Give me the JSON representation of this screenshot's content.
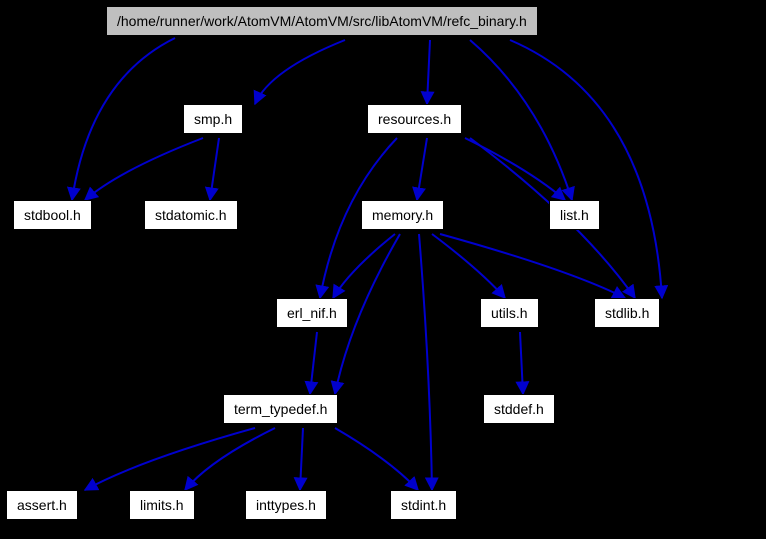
{
  "nodes": {
    "root": {
      "label": "/home/runner/work/AtomVM/AtomVM/src/libAtomVM/refc_binary.h"
    },
    "smp": {
      "label": "smp.h"
    },
    "resources": {
      "label": "resources.h"
    },
    "stdbool": {
      "label": "stdbool.h"
    },
    "stdatomic": {
      "label": "stdatomic.h"
    },
    "memory": {
      "label": "memory.h"
    },
    "list": {
      "label": "list.h"
    },
    "erl_nif": {
      "label": "erl_nif.h"
    },
    "utils": {
      "label": "utils.h"
    },
    "stdlib": {
      "label": "stdlib.h"
    },
    "term_typedef": {
      "label": "term_typedef.h"
    },
    "stddef": {
      "label": "stddef.h"
    },
    "assert": {
      "label": "assert.h"
    },
    "limits": {
      "label": "limits.h"
    },
    "inttypes": {
      "label": "inttypes.h"
    },
    "stdint": {
      "label": "stdint.h"
    }
  },
  "edges": [
    {
      "from": "root",
      "to": "smp"
    },
    {
      "from": "root",
      "to": "resources"
    },
    {
      "from": "root",
      "to": "stdbool"
    },
    {
      "from": "root",
      "to": "list"
    },
    {
      "from": "root",
      "to": "stdlib"
    },
    {
      "from": "smp",
      "to": "stdbool"
    },
    {
      "from": "smp",
      "to": "stdatomic"
    },
    {
      "from": "resources",
      "to": "memory"
    },
    {
      "from": "resources",
      "to": "list"
    },
    {
      "from": "resources",
      "to": "erl_nif"
    },
    {
      "from": "resources",
      "to": "stdlib"
    },
    {
      "from": "memory",
      "to": "erl_nif"
    },
    {
      "from": "memory",
      "to": "term_typedef"
    },
    {
      "from": "memory",
      "to": "utils"
    },
    {
      "from": "memory",
      "to": "stdlib"
    },
    {
      "from": "memory",
      "to": "stdint"
    },
    {
      "from": "erl_nif",
      "to": "term_typedef"
    },
    {
      "from": "utils",
      "to": "stddef"
    },
    {
      "from": "term_typedef",
      "to": "assert"
    },
    {
      "from": "term_typedef",
      "to": "limits"
    },
    {
      "from": "term_typedef",
      "to": "inttypes"
    },
    {
      "from": "term_typedef",
      "to": "stdint"
    }
  ]
}
